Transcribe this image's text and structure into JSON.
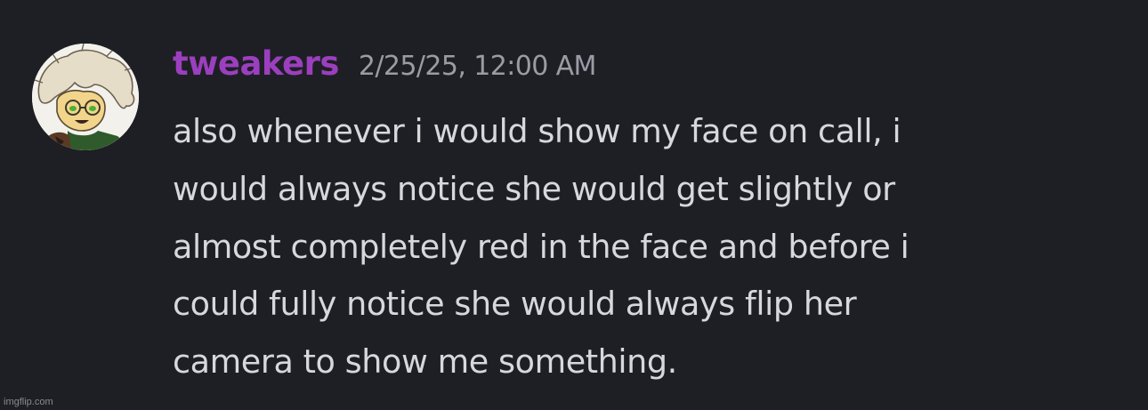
{
  "message": {
    "avatar_icon": "user-avatar-icon",
    "username": "tweakers",
    "username_color": "#9b3fbf",
    "timestamp": "2/25/25, 12:00 AM",
    "lines": [
      "also whenever i would show my face on call, i",
      "would always notice she would get slightly or",
      "almost completely red in the face and before i",
      "could fully notice she would always flip her",
      "camera to show me something."
    ]
  },
  "watermark": "imgflip.com",
  "colors": {
    "background": "#1e1f24",
    "text": "#d7d8dc",
    "timestamp": "#9a9ca5"
  }
}
